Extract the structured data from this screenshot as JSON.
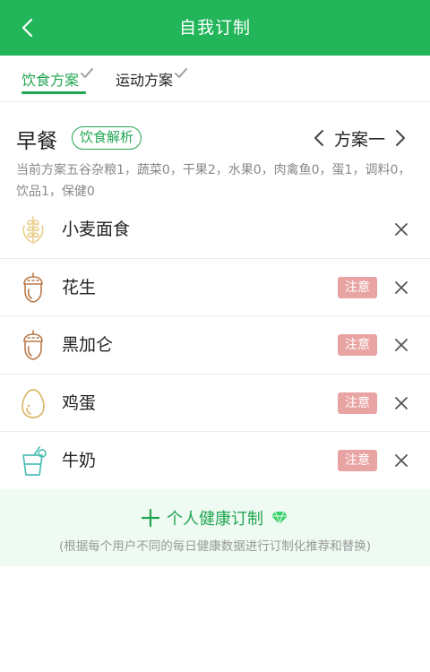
{
  "colors": {
    "brand": "#22b55a",
    "accent": "#22a552",
    "warning": "#e8a3a3",
    "banner_bg": "#eefaf2"
  },
  "header": {
    "title": "自我订制",
    "back_icon": "chevron-left-icon"
  },
  "tabs": [
    {
      "label": "饮食方案",
      "active": true
    },
    {
      "label": "运动方案",
      "active": false
    }
  ],
  "meal": {
    "title": "早餐",
    "analysis_label": "饮食解析",
    "plan_name": "方案一",
    "summary": "当前方案五谷杂粮1，蔬菜0，干果2，水果0，肉禽鱼0，蛋1，调料0，饮品1，保健0"
  },
  "foods": [
    {
      "name": "小麦面食",
      "icon": "wheat-icon",
      "warning": ""
    },
    {
      "name": "花生",
      "icon": "nut-icon",
      "warning": "注意"
    },
    {
      "name": "黑加仑",
      "icon": "nut-icon",
      "warning": "注意"
    },
    {
      "name": "鸡蛋",
      "icon": "egg-icon",
      "warning": "注意"
    },
    {
      "name": "牛奶",
      "icon": "drink-icon",
      "warning": "注意"
    }
  ],
  "custom": {
    "title": "个人健康订制",
    "subtitle": "(根据每个用户不同的每日健康数据进行订制化推荐和替换)"
  }
}
